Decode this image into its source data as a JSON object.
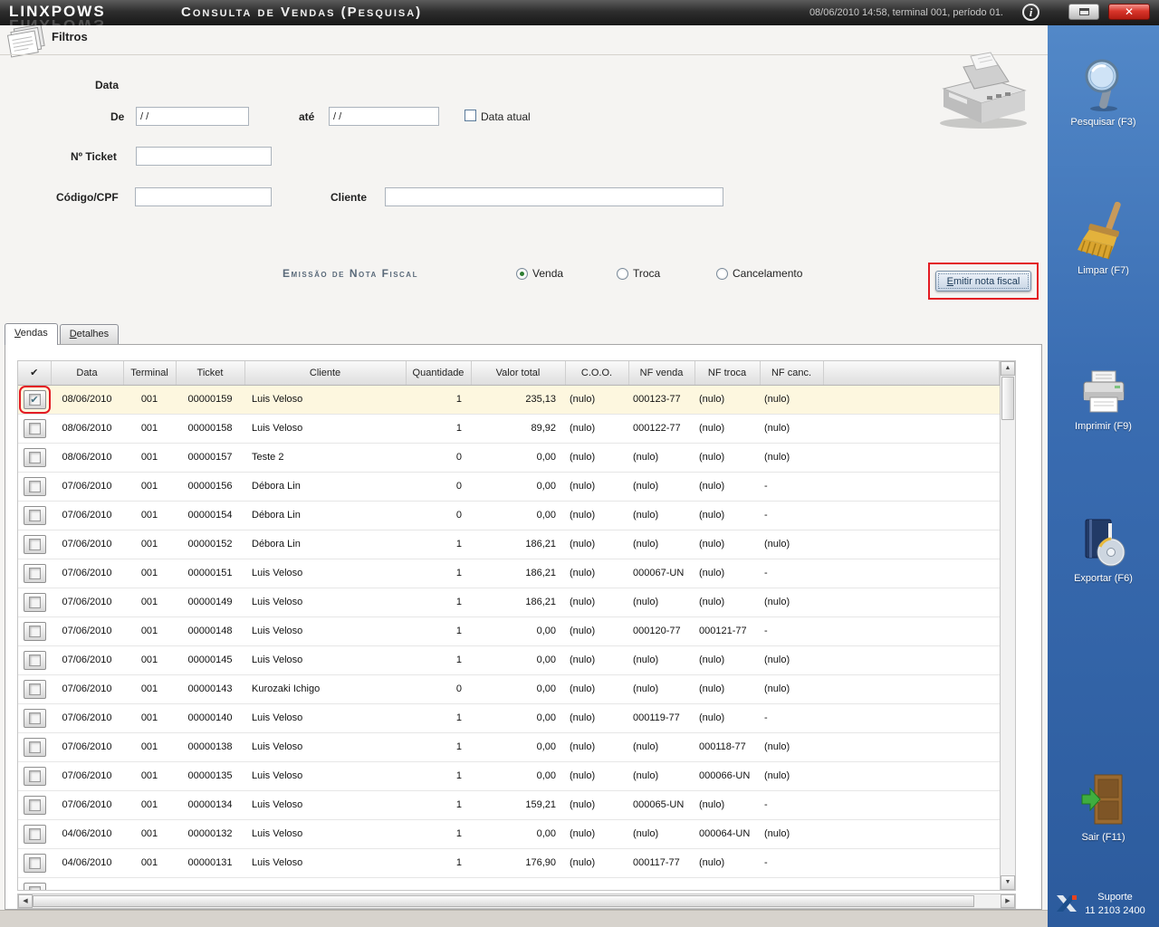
{
  "titlebar": {
    "logo": "LINXPOWS",
    "title": "Consulta de Vendas (Pesquisa)",
    "status": "08/06/2010 14:58, terminal 001, período 01.",
    "info_glyph": "i",
    "close_glyph": "✕"
  },
  "filters": {
    "heading": "Filtros",
    "date_section_label": "Data",
    "from_label": "De",
    "from_value": "/ /",
    "to_label": "até",
    "to_value": "/ /",
    "current_date_label": "Data atual",
    "ticket_label": "Nº Ticket",
    "ticket_value": "",
    "code_label": "Código/CPF",
    "code_value": "",
    "client_label": "Cliente",
    "client_value": "",
    "invoice_section_label": "Emissão de Nota Fiscal",
    "invoice_options": [
      {
        "label": "Venda",
        "selected": true
      },
      {
        "label": "Troca",
        "selected": false
      },
      {
        "label": "Cancelamento",
        "selected": false
      }
    ],
    "emit_button_label": "Emitir nota fiscal"
  },
  "tabs": [
    {
      "label": "Vendas",
      "active": true
    },
    {
      "label": "Detalhes",
      "active": false
    }
  ],
  "table": {
    "headers": [
      "✔",
      "Data",
      "Terminal",
      "Ticket",
      "Cliente",
      "Quantidade",
      "Valor total",
      "C.O.O.",
      "NF venda",
      "NF troca",
      "NF canc."
    ],
    "rows": [
      {
        "checked": true,
        "annotated": true,
        "data": "08/06/2010",
        "terminal": "001",
        "ticket": "00000159",
        "cliente": "Luis Veloso",
        "quantidade": "1",
        "valor_total": "235,13",
        "coo": "(nulo)",
        "nf_venda": "000123-77",
        "nf_troca": "(nulo)",
        "nf_canc": "(nulo)"
      },
      {
        "checked": false,
        "annotated": false,
        "data": "08/06/2010",
        "terminal": "001",
        "ticket": "00000158",
        "cliente": "Luis Veloso",
        "quantidade": "1",
        "valor_total": "89,92",
        "coo": "(nulo)",
        "nf_venda": "000122-77",
        "nf_troca": "(nulo)",
        "nf_canc": "(nulo)"
      },
      {
        "checked": false,
        "annotated": false,
        "data": "08/06/2010",
        "terminal": "001",
        "ticket": "00000157",
        "cliente": "Teste 2",
        "quantidade": "0",
        "valor_total": "0,00",
        "coo": "(nulo)",
        "nf_venda": "(nulo)",
        "nf_troca": "(nulo)",
        "nf_canc": "(nulo)"
      },
      {
        "checked": false,
        "annotated": false,
        "data": "07/06/2010",
        "terminal": "001",
        "ticket": "00000156",
        "cliente": "Débora Lin",
        "quantidade": "0",
        "valor_total": "0,00",
        "coo": "(nulo)",
        "nf_venda": "(nulo)",
        "nf_troca": "(nulo)",
        "nf_canc": "-"
      },
      {
        "checked": false,
        "annotated": false,
        "data": "07/06/2010",
        "terminal": "001",
        "ticket": "00000154",
        "cliente": "Débora Lin",
        "quantidade": "0",
        "valor_total": "0,00",
        "coo": "(nulo)",
        "nf_venda": "(nulo)",
        "nf_troca": "(nulo)",
        "nf_canc": "-"
      },
      {
        "checked": false,
        "annotated": false,
        "data": "07/06/2010",
        "terminal": "001",
        "ticket": "00000152",
        "cliente": "Débora Lin",
        "quantidade": "1",
        "valor_total": "186,21",
        "coo": "(nulo)",
        "nf_venda": "(nulo)",
        "nf_troca": "(nulo)",
        "nf_canc": "(nulo)"
      },
      {
        "checked": false,
        "annotated": false,
        "data": "07/06/2010",
        "terminal": "001",
        "ticket": "00000151",
        "cliente": "Luis Veloso",
        "quantidade": "1",
        "valor_total": "186,21",
        "coo": "(nulo)",
        "nf_venda": "000067-UN",
        "nf_troca": "(nulo)",
        "nf_canc": "-"
      },
      {
        "checked": false,
        "annotated": false,
        "data": "07/06/2010",
        "terminal": "001",
        "ticket": "00000149",
        "cliente": "Luis Veloso",
        "quantidade": "1",
        "valor_total": "186,21",
        "coo": "(nulo)",
        "nf_venda": "(nulo)",
        "nf_troca": "(nulo)",
        "nf_canc": "(nulo)"
      },
      {
        "checked": false,
        "annotated": false,
        "data": "07/06/2010",
        "terminal": "001",
        "ticket": "00000148",
        "cliente": "Luis Veloso",
        "quantidade": "1",
        "valor_total": "0,00",
        "coo": "(nulo)",
        "nf_venda": "000120-77",
        "nf_troca": "000121-77",
        "nf_canc": "-"
      },
      {
        "checked": false,
        "annotated": false,
        "data": "07/06/2010",
        "terminal": "001",
        "ticket": "00000145",
        "cliente": "Luis Veloso",
        "quantidade": "1",
        "valor_total": "0,00",
        "coo": "(nulo)",
        "nf_venda": "(nulo)",
        "nf_troca": "(nulo)",
        "nf_canc": "(nulo)"
      },
      {
        "checked": false,
        "annotated": false,
        "data": "07/06/2010",
        "terminal": "001",
        "ticket": "00000143",
        "cliente": "Kurozaki Ichigo",
        "quantidade": "0",
        "valor_total": "0,00",
        "coo": "(nulo)",
        "nf_venda": "(nulo)",
        "nf_troca": "(nulo)",
        "nf_canc": "(nulo)"
      },
      {
        "checked": false,
        "annotated": false,
        "data": "07/06/2010",
        "terminal": "001",
        "ticket": "00000140",
        "cliente": "Luis Veloso",
        "quantidade": "1",
        "valor_total": "0,00",
        "coo": "(nulo)",
        "nf_venda": "000119-77",
        "nf_troca": "(nulo)",
        "nf_canc": "-"
      },
      {
        "checked": false,
        "annotated": false,
        "data": "07/06/2010",
        "terminal": "001",
        "ticket": "00000138",
        "cliente": "Luis Veloso",
        "quantidade": "1",
        "valor_total": "0,00",
        "coo": "(nulo)",
        "nf_venda": "(nulo)",
        "nf_troca": "000118-77",
        "nf_canc": "(nulo)"
      },
      {
        "checked": false,
        "annotated": false,
        "data": "07/06/2010",
        "terminal": "001",
        "ticket": "00000135",
        "cliente": "Luis Veloso",
        "quantidade": "1",
        "valor_total": "0,00",
        "coo": "(nulo)",
        "nf_venda": "(nulo)",
        "nf_troca": "000066-UN",
        "nf_canc": "(nulo)"
      },
      {
        "checked": false,
        "annotated": false,
        "data": "07/06/2010",
        "terminal": "001",
        "ticket": "00000134",
        "cliente": "Luis Veloso",
        "quantidade": "1",
        "valor_total": "159,21",
        "coo": "(nulo)",
        "nf_venda": "000065-UN",
        "nf_troca": "(nulo)",
        "nf_canc": "-"
      },
      {
        "checked": false,
        "annotated": false,
        "data": "04/06/2010",
        "terminal": "001",
        "ticket": "00000132",
        "cliente": "Luis Veloso",
        "quantidade": "1",
        "valor_total": "0,00",
        "coo": "(nulo)",
        "nf_venda": "(nulo)",
        "nf_troca": "000064-UN",
        "nf_canc": "(nulo)"
      },
      {
        "checked": false,
        "annotated": false,
        "data": "04/06/2010",
        "terminal": "001",
        "ticket": "00000131",
        "cliente": "Luis Veloso",
        "quantidade": "1",
        "valor_total": "176,90",
        "coo": "(nulo)",
        "nf_venda": "000117-77",
        "nf_troca": "(nulo)",
        "nf_canc": "-"
      }
    ]
  },
  "sidebar": {
    "buttons": [
      {
        "label": "Pesquisar (F3)",
        "icon": "magnifier-icon"
      },
      {
        "label": "Limpar (F7)",
        "icon": "broom-icon"
      },
      {
        "label": "Imprimir (F9)",
        "icon": "printer-icon"
      },
      {
        "label": "Exportar (F6)",
        "icon": "export-icon"
      },
      {
        "label": "Sair (F11)",
        "icon": "door-icon"
      }
    ],
    "support_label": "Suporte",
    "support_phone": "11 2103 2400"
  },
  "colors": {
    "sidebar_blue": "#3a6db2",
    "annotation_red": "#e31b23",
    "selected_row": "#fdf7df",
    "titlebar_dark": "#2e2e2e"
  }
}
